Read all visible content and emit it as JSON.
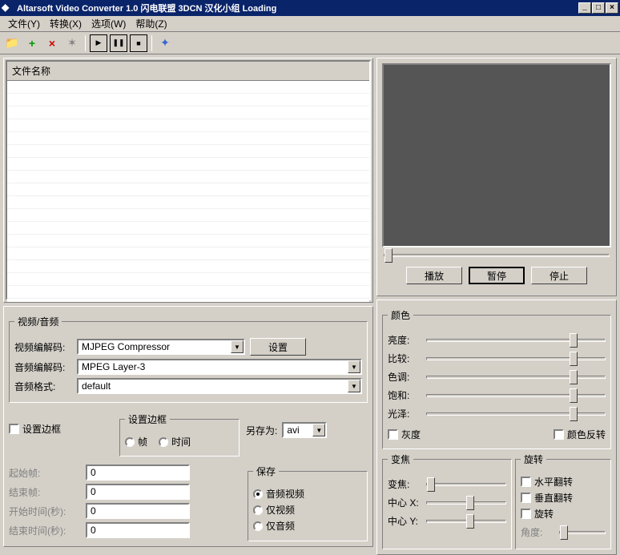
{
  "title": "Altarsoft Video Converter 1.0 闪电联盟 3DCN 汉化小组 Loading",
  "menu": {
    "file": "文件(Y)",
    "convert": "转换(X)",
    "options": "选项(W)",
    "help": "帮助(Z)"
  },
  "filelist": {
    "header": "文件名称"
  },
  "video_audio": {
    "legend": "视频/音频",
    "video_codec_label": "视频编解码:",
    "video_codec_value": "MJPEG Compressor",
    "settings_btn": "设置",
    "audio_codec_label": "音频编解码:",
    "audio_codec_value": "MPEG Layer-3",
    "audio_format_label": "音频格式:",
    "audio_format_value": "default"
  },
  "border": {
    "set_border_cb": "设置边框",
    "legend": "设置边框",
    "frame": "帧",
    "time": "时间"
  },
  "saveas": {
    "label": "另存为:",
    "value": "avi"
  },
  "frames": {
    "start_frame": "起始帧:",
    "end_frame": "结束帧:",
    "start_time": "开始时间(秒):",
    "end_time": "结束时间(秒):",
    "val0": "0"
  },
  "save": {
    "legend": "保存",
    "av": "音频视频",
    "video_only": "仅视频",
    "audio_only": "仅音频"
  },
  "playback": {
    "play": "播放",
    "pause": "暂停",
    "stop": "停止"
  },
  "color": {
    "legend": "颜色",
    "brightness": "亮度:",
    "contrast": "比较:",
    "hue": "色调:",
    "saturation": "饱和:",
    "gloss": "光泽:",
    "grayscale": "灰度",
    "invert": "颜色反转"
  },
  "zoom": {
    "legend": "变焦",
    "zoom": "变焦:",
    "center_x": "中心 X:",
    "center_y": "中心 Y:"
  },
  "rotate": {
    "legend": "旋转",
    "flip_h": "水平翻转",
    "flip_v": "垂直翻转",
    "rotate_cb": "旋转",
    "angle": "角度:"
  }
}
